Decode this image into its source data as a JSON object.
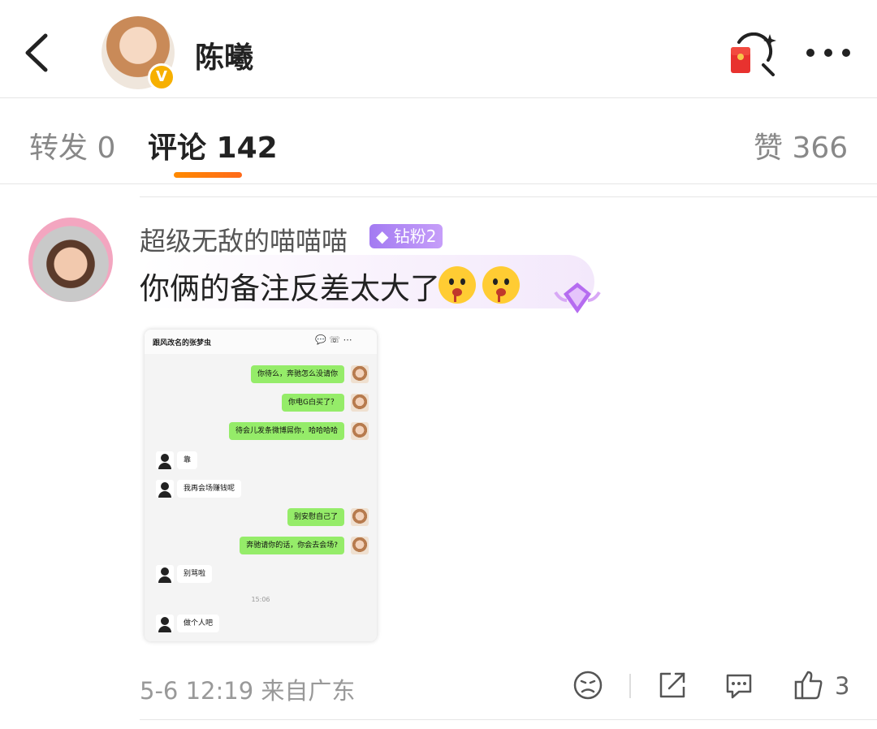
{
  "header": {
    "title": "陈曦",
    "verified_badge": "V",
    "icons": [
      "back-icon",
      "red-packet-search-icon",
      "more-icon"
    ]
  },
  "tabs": [
    {
      "label": "转发 0"
    },
    {
      "label": "评论 142",
      "active": true
    },
    {
      "label": "赞 366"
    }
  ],
  "comment": {
    "author": "超级无敌的喵喵喵",
    "fan_badge": "钻粉2",
    "text": "你俩的备注反差太大了",
    "emojis": [
      "drooling-face-emoji",
      "drooling-face-emoji"
    ],
    "screenshot": {
      "chat_title": "跟风改名的张梦虫",
      "messages": [
        {
          "side": "right",
          "text": "你待么，奔驰怎么没请你"
        },
        {
          "side": "right",
          "text": "你电G白买了？"
        },
        {
          "side": "right",
          "text": "待会儿发条微博屌你，哈哈哈哈"
        },
        {
          "side": "left",
          "text": "靠"
        },
        {
          "side": "left",
          "text": "我再会场赚钱呢"
        },
        {
          "side": "right",
          "text": "别安慰自己了"
        },
        {
          "side": "right",
          "text": "奔驰请你的话，你会去会场?"
        },
        {
          "side": "left",
          "text": "别骂啦"
        },
        {
          "side": "left",
          "text": "做个人吧"
        }
      ],
      "time_divider": "15:06"
    },
    "meta": "5-6 12:19  来自广东",
    "like_count": "3"
  },
  "colors": {
    "accent": "#ff7a00",
    "badge_purple": "#a37bf2",
    "wechat_green": "#95ec69"
  }
}
